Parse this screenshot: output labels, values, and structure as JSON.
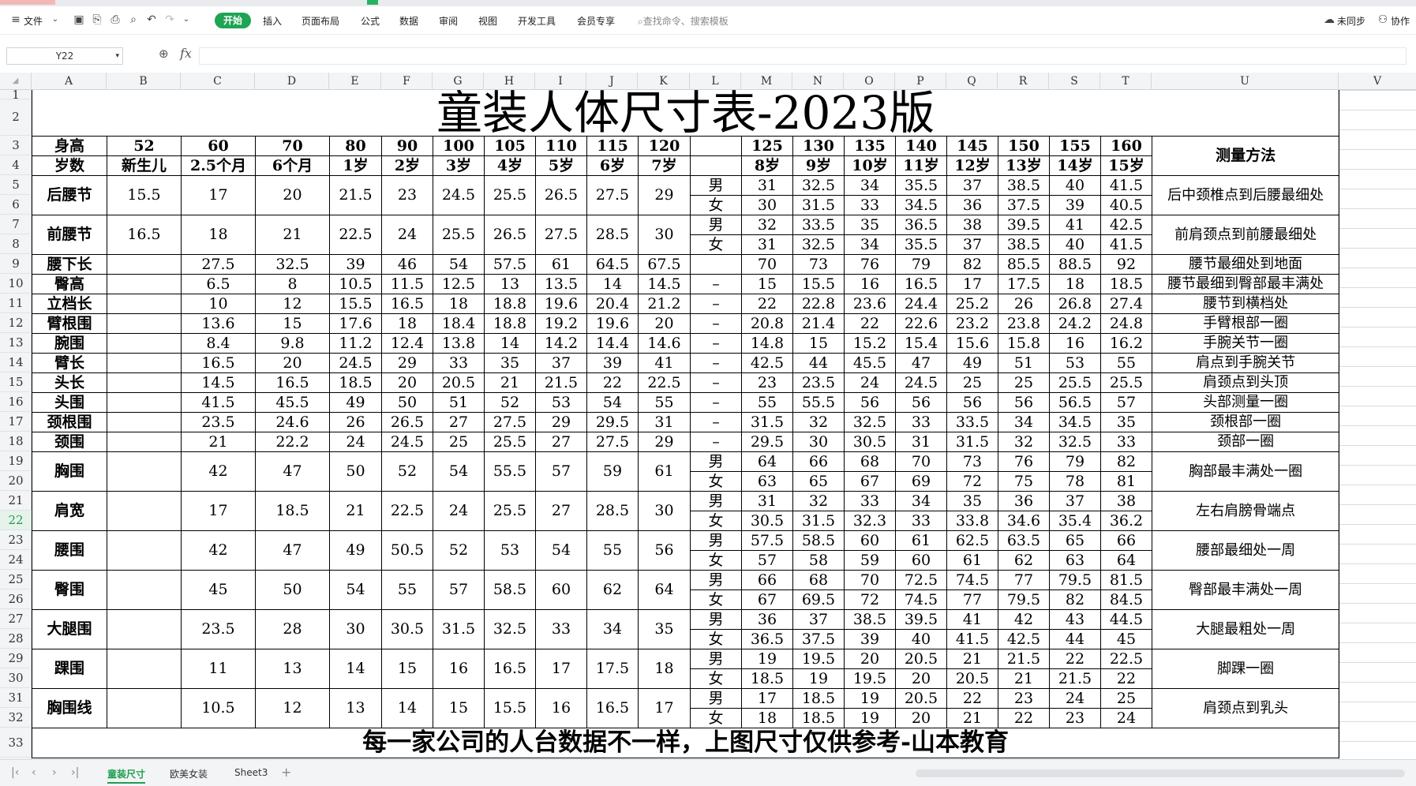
{
  "menu": {
    "file": "文件",
    "start": "开始",
    "tabs": [
      "插入",
      "页面布局",
      "公式",
      "数据",
      "审阅",
      "视图",
      "开发工具",
      "会员专享"
    ],
    "search": "查找命令、搜索模板",
    "sync": "未同步",
    "collab": "协作"
  },
  "formula_bar": {
    "cell_ref": "Y22",
    "fx": "fx",
    "value": ""
  },
  "columns": [
    "A",
    "B",
    "C",
    "D",
    "E",
    "F",
    "G",
    "H",
    "I",
    "J",
    "K",
    "L",
    "M",
    "N",
    "O",
    "P",
    "Q",
    "R",
    "S",
    "T",
    "U",
    "V"
  ],
  "rows": [
    "1",
    "2",
    "3",
    "4",
    "5",
    "6",
    "7",
    "8",
    "9",
    "10",
    "11",
    "12",
    "13",
    "14",
    "15",
    "16",
    "17",
    "18",
    "19",
    "20",
    "21",
    "22",
    "23",
    "24",
    "25",
    "26",
    "27",
    "28",
    "29",
    "30",
    "31",
    "32",
    "33"
  ],
  "selected_row": "22",
  "sheet": {
    "title": "童装人体尺寸表-2023版",
    "height_label": "身高",
    "age_label": "岁数",
    "method_label": "测量方法",
    "heights_left": [
      "52",
      "60",
      "70",
      "80",
      "90",
      "100",
      "105",
      "110",
      "115",
      "120"
    ],
    "ages_left": [
      "新生儿",
      "2.5个月",
      "6个月",
      "1岁",
      "2岁",
      "3岁",
      "4岁",
      "5岁",
      "6岁",
      "7岁"
    ],
    "heights_right": [
      "125",
      "130",
      "135",
      "140",
      "145",
      "150",
      "155",
      "160"
    ],
    "ages_right": [
      "8岁",
      "9岁",
      "10岁",
      "11岁",
      "12岁",
      "13岁",
      "14岁",
      "15岁"
    ],
    "male": "男",
    "female": "女",
    "dash": "–",
    "rows": [
      {
        "label": "后腰节",
        "left": [
          "15.5",
          "17",
          "20",
          "21.5",
          "23",
          "24.5",
          "25.5",
          "26.5",
          "27.5",
          "29"
        ],
        "male": [
          "31",
          "32.5",
          "34",
          "35.5",
          "37",
          "38.5",
          "40",
          "41.5"
        ],
        "female": [
          "30",
          "31.5",
          "33",
          "34.5",
          "36",
          "37.5",
          "39",
          "40.5"
        ],
        "method": "后中颈椎点到后腰最细处"
      },
      {
        "label": "前腰节",
        "left": [
          "16.5",
          "18",
          "21",
          "22.5",
          "24",
          "25.5",
          "26.5",
          "27.5",
          "28.5",
          "30"
        ],
        "male": [
          "32",
          "33.5",
          "35",
          "36.5",
          "38",
          "39.5",
          "41",
          "42.5"
        ],
        "female": [
          "31",
          "32.5",
          "34",
          "35.5",
          "37",
          "38.5",
          "40",
          "41.5"
        ],
        "method": "前肩颈点到前腰最细处"
      },
      {
        "label": "腰下长",
        "left": [
          "",
          "27.5",
          "32.5",
          "39",
          "46",
          "54",
          "57.5",
          "61",
          "64.5",
          "67.5"
        ],
        "right": [
          "70",
          "73",
          "76",
          "79",
          "82",
          "85.5",
          "88.5",
          "92"
        ],
        "mark": "",
        "method": "腰节最细处到地面"
      },
      {
        "label": "臀高",
        "left": [
          "",
          "6.5",
          "8",
          "10.5",
          "11.5",
          "12.5",
          "13",
          "13.5",
          "14",
          "14.5"
        ],
        "right": [
          "15",
          "15.5",
          "16",
          "16.5",
          "17",
          "17.5",
          "18",
          "18.5"
        ],
        "mark": "–",
        "method": "腰节最细到臀部最丰满处"
      },
      {
        "label": "立档长",
        "left": [
          "",
          "10",
          "12",
          "15.5",
          "16.5",
          "18",
          "18.8",
          "19.6",
          "20.4",
          "21.2"
        ],
        "right": [
          "22",
          "22.8",
          "23.6",
          "24.4",
          "25.2",
          "26",
          "26.8",
          "27.4"
        ],
        "mark": "–",
        "method": "腰节到横档处"
      },
      {
        "label": "臂根围",
        "left": [
          "",
          "13.6",
          "15",
          "17.6",
          "18",
          "18.4",
          "18.8",
          "19.2",
          "19.6",
          "20"
        ],
        "right": [
          "20.8",
          "21.4",
          "22",
          "22.6",
          "23.2",
          "23.8",
          "24.2",
          "24.8"
        ],
        "mark": "–",
        "method": "手臂根部一圈"
      },
      {
        "label": "腕围",
        "left": [
          "",
          "8.4",
          "9.8",
          "11.2",
          "12.4",
          "13.8",
          "14",
          "14.2",
          "14.4",
          "14.6"
        ],
        "right": [
          "14.8",
          "15",
          "15.2",
          "15.4",
          "15.6",
          "15.8",
          "16",
          "16.2"
        ],
        "mark": "–",
        "method": "手腕关节一圈"
      },
      {
        "label": "臂长",
        "left": [
          "",
          "16.5",
          "20",
          "24.5",
          "29",
          "33",
          "35",
          "37",
          "39",
          "41"
        ],
        "right": [
          "42.5",
          "44",
          "45.5",
          "47",
          "49",
          "51",
          "53",
          "55"
        ],
        "mark": "–",
        "method": "肩点到手腕关节"
      },
      {
        "label": "头长",
        "left": [
          "",
          "14.5",
          "16.5",
          "18.5",
          "20",
          "20.5",
          "21",
          "21.5",
          "22",
          "22.5"
        ],
        "right": [
          "23",
          "23.5",
          "24",
          "24.5",
          "25",
          "25",
          "25.5",
          "25.5"
        ],
        "mark": "–",
        "method": "肩颈点到头顶"
      },
      {
        "label": "头围",
        "left": [
          "",
          "41.5",
          "45.5",
          "49",
          "50",
          "51",
          "52",
          "53",
          "54",
          "55"
        ],
        "right": [
          "55",
          "55.5",
          "56",
          "56",
          "56",
          "56",
          "56.5",
          "57"
        ],
        "mark": "–",
        "method": "头部测量一圈"
      },
      {
        "label": "颈根围",
        "left": [
          "",
          "23.5",
          "24.6",
          "26",
          "26.5",
          "27",
          "27.5",
          "29",
          "29.5",
          "31"
        ],
        "right": [
          "31.5",
          "32",
          "32.5",
          "33",
          "33.5",
          "34",
          "34.5",
          "35"
        ],
        "mark": "–",
        "method": "颈根部一圈"
      },
      {
        "label": "颈围",
        "left": [
          "",
          "21",
          "22.2",
          "24",
          "24.5",
          "25",
          "25.5",
          "27",
          "27.5",
          "29"
        ],
        "right": [
          "29.5",
          "30",
          "30.5",
          "31",
          "31.5",
          "32",
          "32.5",
          "33"
        ],
        "mark": "–",
        "method": "颈部一圈"
      },
      {
        "label": "胸围",
        "left": [
          "",
          "42",
          "47",
          "50",
          "52",
          "54",
          "55.5",
          "57",
          "59",
          "61"
        ],
        "male": [
          "64",
          "66",
          "68",
          "70",
          "73",
          "76",
          "79",
          "82"
        ],
        "female": [
          "63",
          "65",
          "67",
          "69",
          "72",
          "75",
          "78",
          "81"
        ],
        "method": "胸部最丰满处一圈"
      },
      {
        "label": "肩宽",
        "left": [
          "",
          "17",
          "18.5",
          "21",
          "22.5",
          "24",
          "25.5",
          "27",
          "28.5",
          "30"
        ],
        "male": [
          "31",
          "32",
          "33",
          "34",
          "35",
          "36",
          "37",
          "38"
        ],
        "female": [
          "30.5",
          "31.5",
          "32.3",
          "33",
          "33.8",
          "34.6",
          "35.4",
          "36.2"
        ],
        "method": "左右肩膀骨端点"
      },
      {
        "label": "腰围",
        "left": [
          "",
          "42",
          "47",
          "49",
          "50.5",
          "52",
          "53",
          "54",
          "55",
          "56"
        ],
        "male": [
          "57.5",
          "58.5",
          "60",
          "61",
          "62.5",
          "63.5",
          "65",
          "66"
        ],
        "female": [
          "57",
          "58",
          "59",
          "60",
          "61",
          "62",
          "63",
          "64"
        ],
        "method": "腰部最细处一周"
      },
      {
        "label": "臀围",
        "left": [
          "",
          "45",
          "50",
          "54",
          "55",
          "57",
          "58.5",
          "60",
          "62",
          "64"
        ],
        "male": [
          "66",
          "68",
          "70",
          "72.5",
          "74.5",
          "77",
          "79.5",
          "81.5"
        ],
        "female": [
          "67",
          "69.5",
          "72",
          "74.5",
          "77",
          "79.5",
          "82",
          "84.5"
        ],
        "method": "臀部最丰满处一周"
      },
      {
        "label": "大腿围",
        "left": [
          "",
          "23.5",
          "28",
          "30",
          "30.5",
          "31.5",
          "32.5",
          "33",
          "34",
          "35"
        ],
        "male": [
          "36",
          "37",
          "38.5",
          "39.5",
          "41",
          "42",
          "43",
          "44.5"
        ],
        "female": [
          "36.5",
          "37.5",
          "39",
          "40",
          "41.5",
          "42.5",
          "44",
          "45"
        ],
        "method": "大腿最粗处一周"
      },
      {
        "label": "踝围",
        "left": [
          "",
          "11",
          "13",
          "14",
          "15",
          "16",
          "16.5",
          "17",
          "17.5",
          "18"
        ],
        "male": [
          "19",
          "19.5",
          "20",
          "20.5",
          "21",
          "21.5",
          "22",
          "22.5"
        ],
        "female": [
          "18.5",
          "19",
          "19.5",
          "20",
          "20.5",
          "21",
          "21.5",
          "22"
        ],
        "method": "脚踝一圈"
      },
      {
        "label": "胸围线",
        "left": [
          "",
          "10.5",
          "12",
          "13",
          "14",
          "15",
          "15.5",
          "16",
          "16.5",
          "17"
        ],
        "male": [
          "17",
          "18.5",
          "19",
          "20.5",
          "22",
          "23",
          "24",
          "25"
        ],
        "female": [
          "18",
          "18.5",
          "19",
          "20",
          "21",
          "22",
          "23",
          "24"
        ],
        "method": "肩颈点到乳头"
      }
    ],
    "footer": "每一家公司的人台数据不一样，上图尺寸仅供参考-山本教育"
  },
  "sheet_tabs": [
    "童装尺寸",
    "欧美女装",
    "Sheet3"
  ],
  "active_tab": "童装尺寸"
}
